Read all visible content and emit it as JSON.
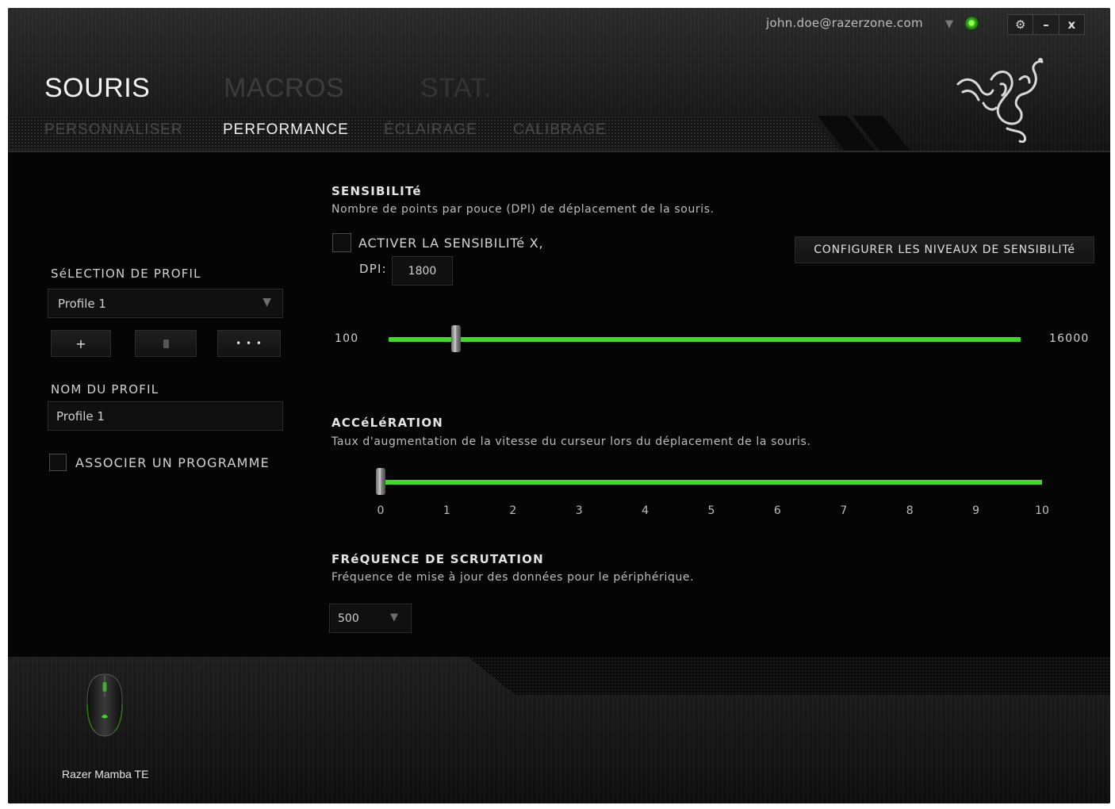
{
  "header": {
    "email": "john.doe@razerzone.com",
    "tabs": [
      {
        "label": "SOURIS",
        "active": true
      },
      {
        "label": "MACROS",
        "active": false
      },
      {
        "label": "STAT.",
        "active": false
      }
    ],
    "subtabs": [
      {
        "label": "PERSONNALISER",
        "active": false
      },
      {
        "label": "PERFORMANCE",
        "active": true
      },
      {
        "label": "ÉCLAIRAGE",
        "active": false
      },
      {
        "label": "CALIBRAGE",
        "active": false
      }
    ],
    "controls": {
      "settings": "⚙",
      "minimize": "–",
      "close": "x"
    }
  },
  "profile": {
    "selection_label": "SéLECTION DE PROFIL",
    "selected": "Profile 1",
    "add_label": "+",
    "more_label": "• • •",
    "name_label": "NOM DU PROFIL",
    "name_value": "Profile 1",
    "link_program_label": "ASSOCIER UN PROGRAMME",
    "link_program_checked": false
  },
  "sensitivity": {
    "title": "SENSIBILITé",
    "description": "Nombre de points par pouce (DPI) de déplacement de la souris.",
    "enable_x_label": "ACTIVER LA SENSIBILITé X,",
    "enable_x_checked": false,
    "configure_button": "CONFIGURER LES NIVEAUX DE SENSIBILITé",
    "dpi_label": "DPI:",
    "dpi_value": "1800",
    "min_label": "100",
    "max_label": "16000",
    "min": 100,
    "max": 16000,
    "value": 1800
  },
  "acceleration": {
    "title": "ACCéLéRATION",
    "description": "Taux d'augmentation de la vitesse du curseur lors du déplacement de la souris.",
    "value": 0,
    "ticks": [
      "0",
      "1",
      "2",
      "3",
      "4",
      "5",
      "6",
      "7",
      "8",
      "9",
      "10"
    ]
  },
  "polling": {
    "title": "FRéQUENCE DE SCRUTATION",
    "description": "Fréquence de mise à jour des données pour le périphérique.",
    "value": "500"
  },
  "device": {
    "name": "Razer Mamba TE"
  },
  "colors": {
    "accent": "#44d62c",
    "background": "#050505"
  }
}
